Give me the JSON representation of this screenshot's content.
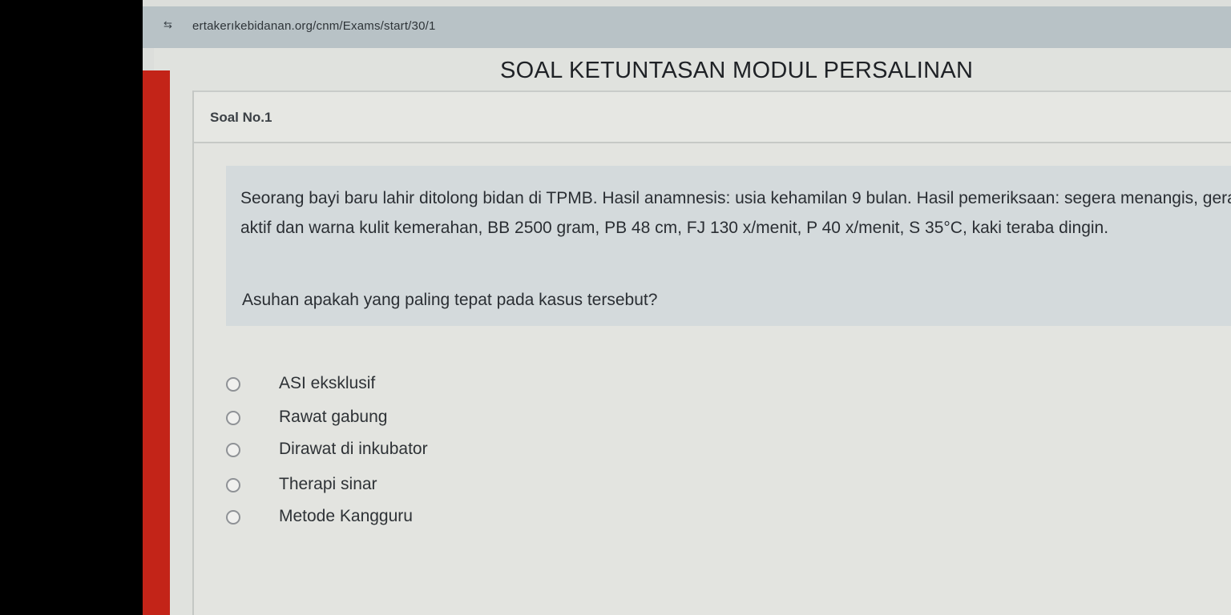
{
  "browser": {
    "url": "ertakerıkebidanan.org/cnm/Exams/start/30/1"
  },
  "page": {
    "title": "SOAL KETUNTASAN MODUL PERSALINAN"
  },
  "question": {
    "number_label": "Soal No.1",
    "text": "Seorang bayi baru lahir ditolong bidan di TPMB. Hasil anamnesis: usia kehamilan 9 bulan. Hasil pemeriksaan: segera menangis, gerakan aktif dan warna kulit kemerahan, BB 2500 gram, PB 48 cm, FJ 130 x/menit, P 40 x/menit, S 35°C, kaki teraba dingin.",
    "prompt": "Asuhan apakah yang paling tepat pada kasus tersebut?"
  },
  "options": [
    {
      "label": "ASI eksklusif"
    },
    {
      "label": "Rawat gabung"
    },
    {
      "label": "Dirawat di inkubator"
    },
    {
      "label": "Therapi sinar"
    },
    {
      "label": "Metode Kangguru"
    }
  ],
  "colors": {
    "accent_strip": "#c32418",
    "question_bg": "#d4dadc",
    "address_bar": "#b8c2c6"
  }
}
